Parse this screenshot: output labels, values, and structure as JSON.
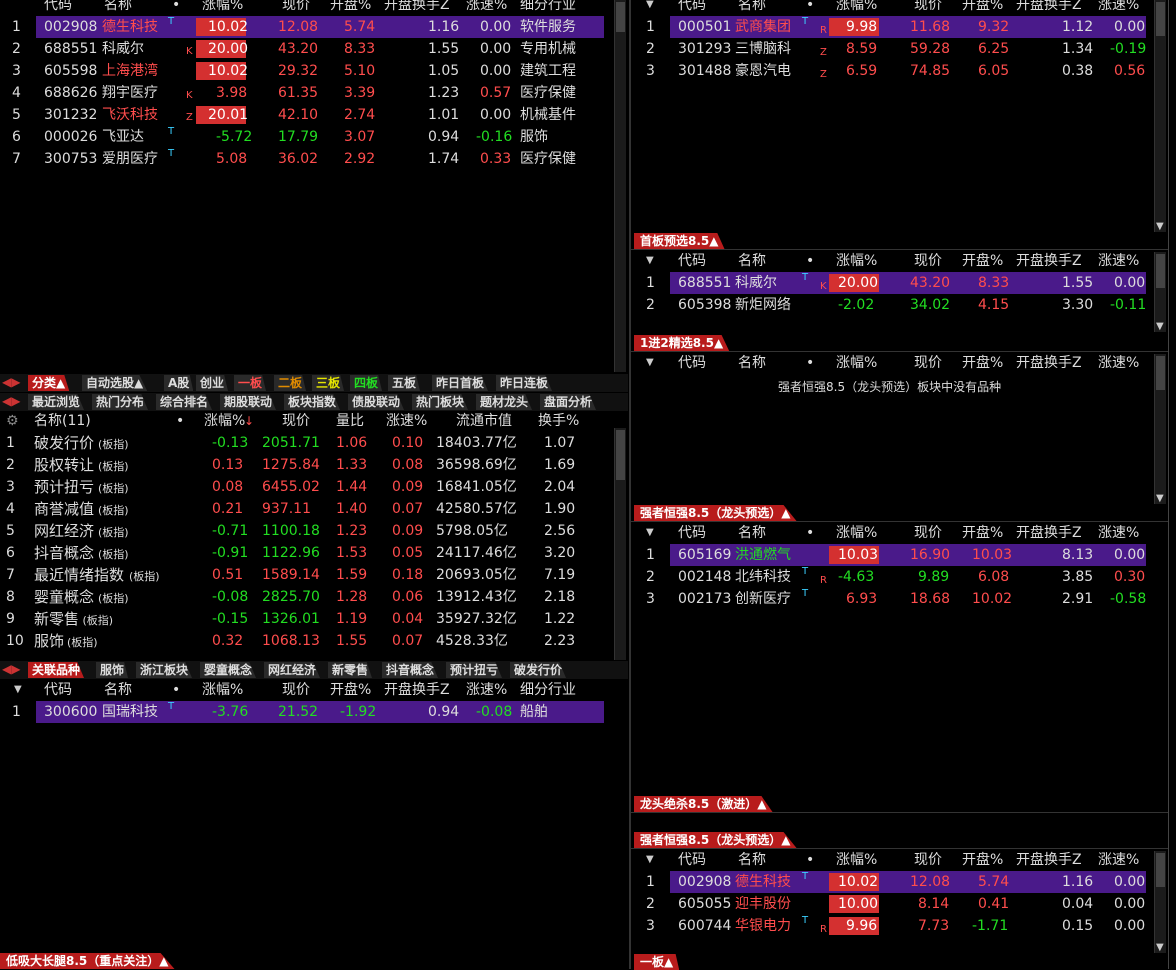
{
  "left_top": {
    "headers": [
      "代码",
      "名称",
      "•",
      "涨幅%",
      "现价",
      "开盘%",
      "开盘换手Z",
      "涨速%",
      "细分行业"
    ],
    "rows": [
      {
        "n": "1",
        "code": "002908",
        "name": "德生科技",
        "tag": "T",
        "chg": "10.02",
        "price": "12.08",
        "open": "5.74",
        "turn": "1.16",
        "spd": "0.00",
        "ind": "软件服务"
      },
      {
        "n": "2",
        "code": "688551",
        "name": "科威尔",
        "tag": "K",
        "chg": "20.00",
        "price": "43.20",
        "open": "8.33",
        "turn": "1.55",
        "spd": "0.00",
        "ind": "专用机械"
      },
      {
        "n": "3",
        "code": "605598",
        "name": "上海港湾",
        "tag": "",
        "chg": "10.02",
        "price": "29.32",
        "open": "5.10",
        "turn": "1.05",
        "spd": "0.00",
        "ind": "建筑工程"
      },
      {
        "n": "4",
        "code": "688626",
        "name": "翔宇医疗",
        "tag": "K",
        "chg": "3.98",
        "price": "61.35",
        "open": "3.39",
        "turn": "1.23",
        "spd": "0.57",
        "ind": "医疗保健"
      },
      {
        "n": "5",
        "code": "301232",
        "name": "飞沃科技",
        "tag": "Z",
        "chg": "20.01",
        "price": "42.10",
        "open": "2.74",
        "turn": "1.01",
        "spd": "0.00",
        "ind": "机械基件"
      },
      {
        "n": "6",
        "code": "000026",
        "name": "飞亚达",
        "tag": "T",
        "chg": "-5.72",
        "price": "17.79",
        "open": "3.07",
        "turn": "0.94",
        "spd": "-0.16",
        "ind": "服饰"
      },
      {
        "n": "7",
        "code": "300753",
        "name": "爱朋医疗",
        "tag": "T",
        "chg": "5.08",
        "price": "36.02",
        "open": "2.92",
        "turn": "1.74",
        "spd": "0.33",
        "ind": "医疗保健"
      }
    ]
  },
  "tabs1": [
    "分类▲",
    "自动选股▲",
    "A股",
    "创业",
    "一板",
    "二板",
    "三板",
    "四板",
    "五板",
    "昨日首板",
    "昨日连板"
  ],
  "tabs2": [
    "最近浏览",
    "热门分布",
    "综合排名",
    "期股联动",
    "板块指数",
    "债股联动",
    "热门板块",
    "题材龙头",
    "盘面分析"
  ],
  "sector": {
    "headers": [
      "名称(11)",
      "•",
      "涨幅%",
      "现价",
      "量比",
      "涨速%",
      "流通市值",
      "换手%"
    ],
    "suffix": "(板指)",
    "rows": [
      {
        "n": "1",
        "name": "破发行价",
        "chg": "-0.13",
        "price": "2051.71",
        "vr": "1.06",
        "spd": "0.10",
        "cap": "18403.77亿",
        "turn": "1.07"
      },
      {
        "n": "2",
        "name": "股权转让",
        "chg": "0.13",
        "price": "1275.84",
        "vr": "1.33",
        "spd": "0.08",
        "cap": "36598.69亿",
        "turn": "1.69"
      },
      {
        "n": "3",
        "name": "预计扭亏",
        "chg": "0.08",
        "price": "6455.02",
        "vr": "1.44",
        "spd": "0.09",
        "cap": "16841.05亿",
        "turn": "2.04"
      },
      {
        "n": "4",
        "name": "商誉减值",
        "chg": "0.21",
        "price": "937.11",
        "vr": "1.40",
        "spd": "0.07",
        "cap": "42580.57亿",
        "turn": "1.90"
      },
      {
        "n": "5",
        "name": "网红经济",
        "chg": "-0.71",
        "price": "1100.18",
        "vr": "1.23",
        "spd": "0.09",
        "cap": "5798.05亿",
        "turn": "2.56"
      },
      {
        "n": "6",
        "name": "抖音概念",
        "chg": "-0.91",
        "price": "1122.96",
        "vr": "1.53",
        "spd": "0.05",
        "cap": "24117.46亿",
        "turn": "3.20"
      },
      {
        "n": "7",
        "name": "最近情绪指数",
        "chg": "0.51",
        "price": "1589.14",
        "vr": "1.59",
        "spd": "0.18",
        "cap": "20693.05亿",
        "turn": "7.19"
      },
      {
        "n": "8",
        "name": "婴童概念",
        "chg": "-0.08",
        "price": "2825.70",
        "vr": "1.28",
        "spd": "0.06",
        "cap": "13912.43亿",
        "turn": "2.18"
      },
      {
        "n": "9",
        "name": "新零售",
        "chg": "-0.15",
        "price": "1326.01",
        "vr": "1.19",
        "spd": "0.04",
        "cap": "35927.32亿",
        "turn": "1.22"
      },
      {
        "n": "10",
        "name": "服饰",
        "chg": "0.32",
        "price": "1068.13",
        "vr": "1.55",
        "spd": "0.07",
        "cap": "4528.33亿",
        "turn": "2.23"
      }
    ]
  },
  "tabs3": [
    "关联品种",
    "服饰",
    "浙江板块",
    "婴童概念",
    "网红经济",
    "新零售",
    "抖音概念",
    "预计扭亏",
    "破发行价"
  ],
  "related": {
    "headers": [
      "代码",
      "名称",
      "•",
      "涨幅%",
      "现价",
      "开盘%",
      "开盘换手Z",
      "涨速%",
      "细分行业"
    ],
    "rows": [
      {
        "n": "1",
        "code": "300600",
        "name": "国瑞科技",
        "tag": "T",
        "chg": "-3.76",
        "price": "21.52",
        "open": "-1.92",
        "turn": "0.94",
        "spd": "-0.08",
        "ind": "船舶"
      }
    ]
  },
  "bottom_left_title": "低吸大长腿8.5（重点关注）▲",
  "rp_headers": [
    "代码",
    "名称",
    "•",
    "涨幅%",
    "现价",
    "开盘%",
    "开盘换手Z",
    "涨速%"
  ],
  "rp1": {
    "rows": [
      {
        "n": "1",
        "code": "000501",
        "name": "武商集团",
        "tag": "T",
        "tag2": "R",
        "chg": "9.98",
        "price": "11.68",
        "open": "9.32",
        "turn": "1.12",
        "spd": "0.00"
      },
      {
        "n": "2",
        "code": "301293",
        "name": "三博脑科",
        "tag": "",
        "tag2": "Z",
        "chg": "8.59",
        "price": "59.28",
        "open": "6.25",
        "turn": "1.34",
        "spd": "-0.19"
      },
      {
        "n": "3",
        "code": "301488",
        "name": "豪恩汽电",
        "tag": "",
        "tag2": "Z",
        "chg": "6.59",
        "price": "74.85",
        "open": "6.05",
        "turn": "0.38",
        "spd": "0.56"
      }
    ]
  },
  "rp2": {
    "title": "首板预选8.5▲",
    "rows": [
      {
        "n": "1",
        "code": "688551",
        "name": "科威尔",
        "tag": "T",
        "tag2": "K",
        "chg": "20.00",
        "price": "43.20",
        "open": "8.33",
        "turn": "1.55",
        "spd": "0.00"
      },
      {
        "n": "2",
        "code": "605398",
        "name": "新炬网络",
        "tag": "",
        "tag2": "",
        "chg": "-2.02",
        "price": "34.02",
        "open": "4.15",
        "turn": "3.30",
        "spd": "-0.11"
      }
    ]
  },
  "rp3": {
    "title": "1进2精选8.5▲",
    "empty": "强者恒强8.5（龙头预选）板块中没有品种"
  },
  "rp4": {
    "title": "强者恒强8.5（龙头预选）▲",
    "rows": [
      {
        "n": "1",
        "code": "605169",
        "name": "洪通燃气",
        "tag": "",
        "tag2": "",
        "chg": "10.03",
        "price": "16.90",
        "open": "10.03",
        "turn": "8.13",
        "spd": "0.00"
      },
      {
        "n": "2",
        "code": "002148",
        "name": "北纬科技",
        "tag": "T",
        "tag2": "R",
        "chg": "-4.63",
        "price": "9.89",
        "open": "6.08",
        "turn": "3.85",
        "spd": "0.30"
      },
      {
        "n": "3",
        "code": "002173",
        "name": "创新医疗",
        "tag": "T",
        "tag2": "",
        "chg": "6.93",
        "price": "18.68",
        "open": "10.02",
        "turn": "2.91",
        "spd": "-0.58"
      }
    ]
  },
  "rp5": {
    "title": "龙头绝杀8.5（激进）▲"
  },
  "rp6": {
    "title": "强者恒强8.5（龙头预选）▲",
    "rows": [
      {
        "n": "1",
        "code": "002908",
        "name": "德生科技",
        "tag": "T",
        "tag2": "",
        "chg": "10.02",
        "price": "12.08",
        "open": "5.74",
        "turn": "1.16",
        "spd": "0.00"
      },
      {
        "n": "2",
        "code": "605055",
        "name": "迎丰股份",
        "tag": "",
        "tag2": "",
        "chg": "10.00",
        "price": "8.14",
        "open": "0.41",
        "turn": "0.04",
        "spd": "0.00"
      },
      {
        "n": "3",
        "code": "600744",
        "name": "华银电力",
        "tag": "T",
        "tag2": "R",
        "chg": "9.96",
        "price": "7.73",
        "open": "-1.71",
        "turn": "0.15",
        "spd": "0.00"
      }
    ]
  },
  "rp7": {
    "title": "一板▲"
  }
}
